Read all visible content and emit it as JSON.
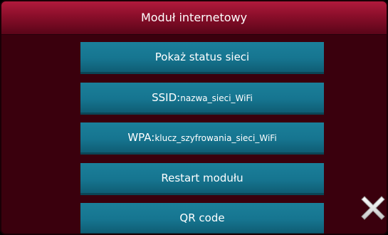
{
  "header": {
    "title": "Moduł internetowy"
  },
  "menu": {
    "status_label": "Pokaż status sieci",
    "ssid_prefix": "SSID:",
    "ssid_value": "nazwa_sieci_WiFi",
    "wpa_prefix": "WPA:",
    "wpa_value": "klucz_szyfrowania_sieci_WiFi",
    "restart_label": "Restart modułu",
    "qr_label": "QR code"
  },
  "icons": {
    "close": "close-icon"
  },
  "colors": {
    "background": "#3a000d",
    "header": "#8a0e2a",
    "button": "#167590",
    "text": "#ffffff"
  }
}
